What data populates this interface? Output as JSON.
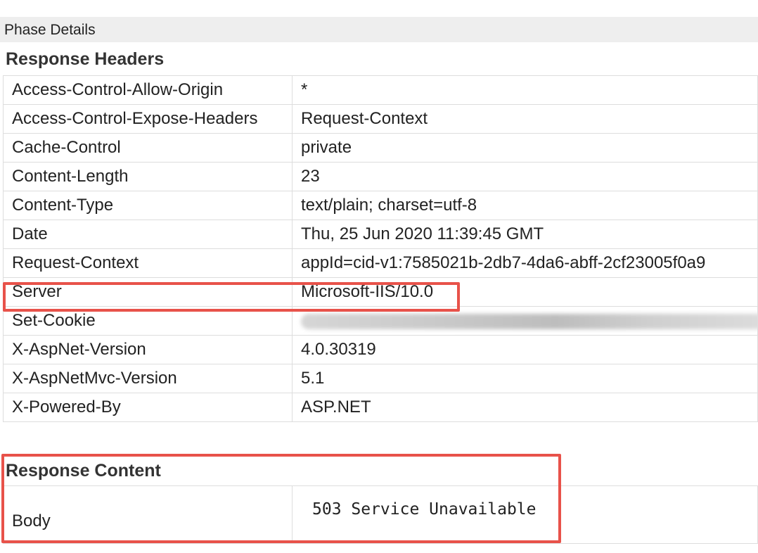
{
  "phase": {
    "title": "Phase Details"
  },
  "response_headers": {
    "title": "Response Headers",
    "rows": [
      {
        "key": "Access-Control-Allow-Origin",
        "value": "*"
      },
      {
        "key": "Access-Control-Expose-Headers",
        "value": "Request-Context"
      },
      {
        "key": "Cache-Control",
        "value": "private"
      },
      {
        "key": "Content-Length",
        "value": "23"
      },
      {
        "key": "Content-Type",
        "value": "text/plain; charset=utf-8"
      },
      {
        "key": "Date",
        "value": "Thu, 25 Jun 2020 11:39:45 GMT"
      },
      {
        "key": "Request-Context",
        "value": "appId=cid-v1:7585021b-2db7-4da6-abff-2cf23005f0a9"
      },
      {
        "key": "Server",
        "value": "Microsoft-IIS/10.0"
      },
      {
        "key": "Set-Cookie",
        "value": ""
      },
      {
        "key": "X-AspNet-Version",
        "value": "4.0.30319"
      },
      {
        "key": "X-AspNetMvc-Version",
        "value": "5.1"
      },
      {
        "key": "X-Powered-By",
        "value": "ASP.NET"
      }
    ]
  },
  "response_content": {
    "title": "Response Content",
    "body_label": "Body",
    "body_value": "503 Service Unavailable"
  },
  "colors": {
    "highlight": "#e8524a",
    "phase_bar": "#eeeeee",
    "border": "#dddddd"
  }
}
